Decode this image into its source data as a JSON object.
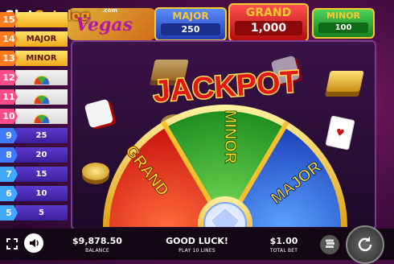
{
  "logo": {
    "brand_part1": "Slot",
    "brand_part2": "Catalog",
    "game_name": "Vegas",
    "com": ".com"
  },
  "jackpots": {
    "major": {
      "label": "MAJOR",
      "amount": "250"
    },
    "grand": {
      "label": "GRAND",
      "amount": "1,000"
    },
    "minor": {
      "label": "MINOR",
      "amount": "100"
    }
  },
  "paytable": [
    {
      "count": "15",
      "value": "",
      "style": "grand"
    },
    {
      "count": "14",
      "value": "MAJOR",
      "style": "big"
    },
    {
      "count": "13",
      "value": "MINOR",
      "style": "big"
    },
    {
      "count": "12",
      "value": "",
      "style": "wheel"
    },
    {
      "count": "11",
      "value": "",
      "style": "wheel"
    },
    {
      "count": "10",
      "value": "",
      "style": "wheel"
    },
    {
      "count": "9",
      "value": "25",
      "style": "num"
    },
    {
      "count": "8",
      "value": "20",
      "style": "num"
    },
    {
      "count": "7",
      "value": "15",
      "style": "num"
    },
    {
      "count": "6",
      "value": "10",
      "style": "num"
    },
    {
      "count": "5",
      "value": "5",
      "style": "num"
    }
  ],
  "wheel": {
    "title": "JACKPOT",
    "segments": {
      "grand": "GRAND",
      "minor": "MINOR",
      "major": "MAJOR"
    },
    "colors": {
      "grand": "#e2231a",
      "minor": "#2fa82f",
      "major": "#2659d8",
      "gold": "#f5c02c"
    }
  },
  "bottom": {
    "balance_value": "$9,878.50",
    "balance_label": "BALANCE",
    "message": "GOOD LUCK!",
    "lines": "PLAY 10 LINES",
    "bet_value": "$1.00",
    "bet_label": "TOTAL BET"
  },
  "icons": [
    "fullscreen-icon",
    "sound-icon",
    "coin-stack-icon",
    "spin-icon"
  ]
}
